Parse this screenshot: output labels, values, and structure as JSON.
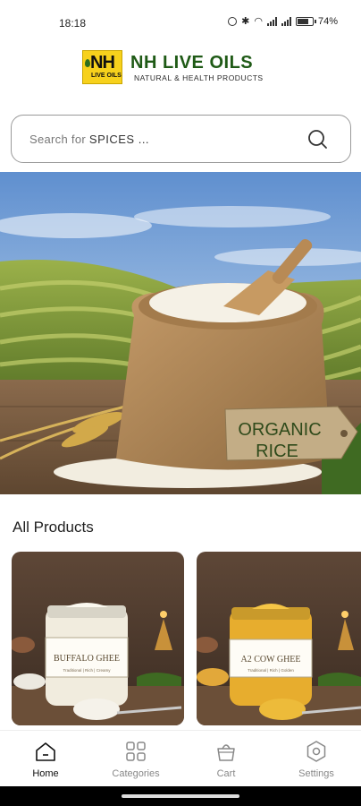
{
  "status_bar": {
    "time": "18:18",
    "battery": "74%"
  },
  "brand": {
    "logo_text": "NH",
    "logo_subtext": "LIVE OILS",
    "name": "NH LIVE OILS",
    "tagline": "NATURAL & HEALTH PRODUCTS"
  },
  "search": {
    "placeholder_prefix": "Search for",
    "placeholder_term": "SPICES ...",
    "icon": "search-icon"
  },
  "banner": {
    "tag_line1": "ORGANIC",
    "tag_line2": "RICE"
  },
  "products_section": {
    "title": "All Products",
    "items": [
      {
        "label_line1": "BUFFALO GHEE",
        "label_line2": "Traditional | Rich | Creamy"
      },
      {
        "label_line1": "A2 COW GHEE",
        "label_line2": "Traditional | Rich | Golden"
      }
    ]
  },
  "bottom_nav": {
    "items": [
      {
        "label": "Home",
        "icon": "home-icon",
        "active": true
      },
      {
        "label": "Categories",
        "icon": "categories-icon",
        "active": false
      },
      {
        "label": "Cart",
        "icon": "cart-icon",
        "active": false
      },
      {
        "label": "Settings",
        "icon": "settings-icon",
        "active": false
      }
    ]
  },
  "colors": {
    "brand_green": "#1f5a16",
    "logo_yellow": "#f7d11c",
    "nav_active": "#111111",
    "nav_inactive": "#888888"
  }
}
